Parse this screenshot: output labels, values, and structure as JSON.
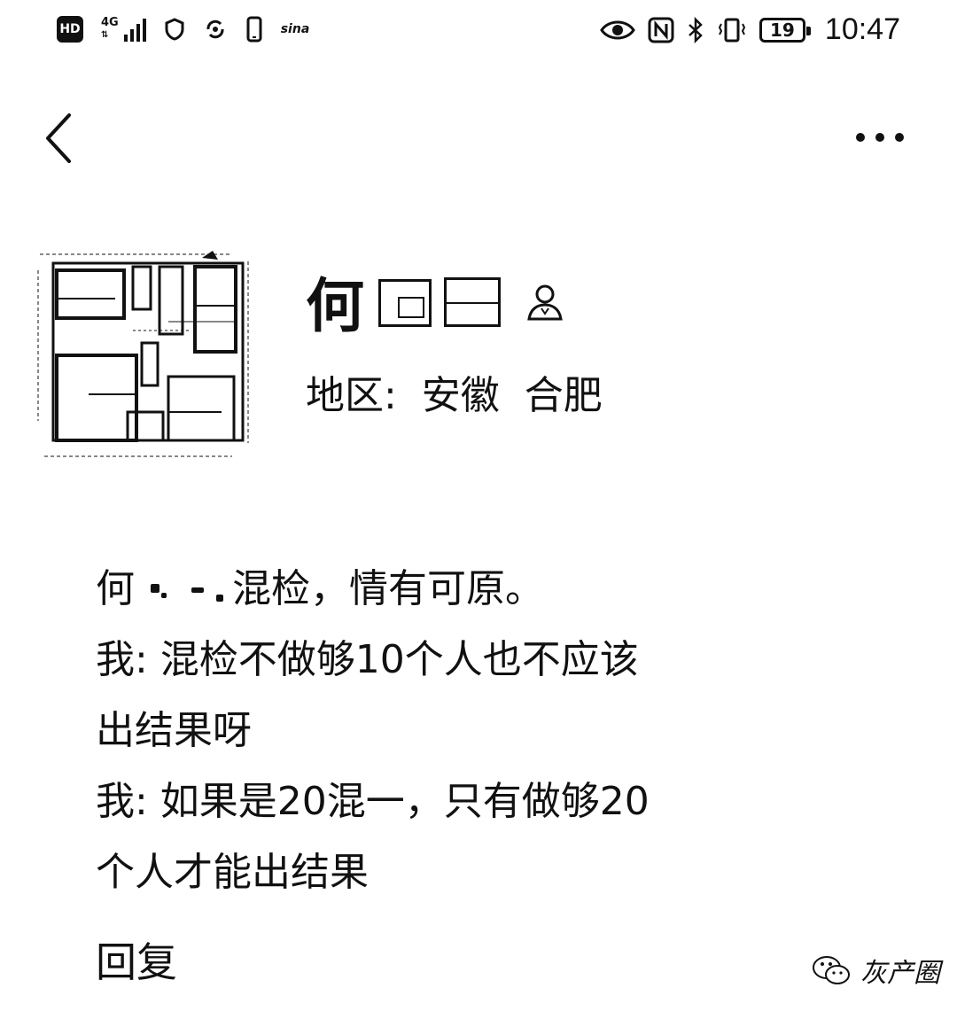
{
  "status_bar": {
    "hd_label": "HD",
    "network_label": "4G",
    "network_sub": "⇅",
    "carrier_logo": "sina",
    "battery_level": "19",
    "time": "10:47"
  },
  "nav": {
    "back_icon": "chevron-left-icon",
    "more_icon": "more-dots-icon"
  },
  "profile": {
    "name": "何",
    "region": "地区:  安徽  合肥"
  },
  "comment": {
    "lines": [
      {
        "prefix": "何",
        "text": "混检，情有可原。"
      },
      {
        "text": "我: 混检不做够10个人也不应该"
      },
      {
        "text": "出结果呀"
      },
      {
        "text": "我: 如果是20混一，只有做够20"
      },
      {
        "text": "个人才能出结果"
      }
    ],
    "reply_label": "回复"
  },
  "watermark": {
    "text": "灰产圈"
  }
}
